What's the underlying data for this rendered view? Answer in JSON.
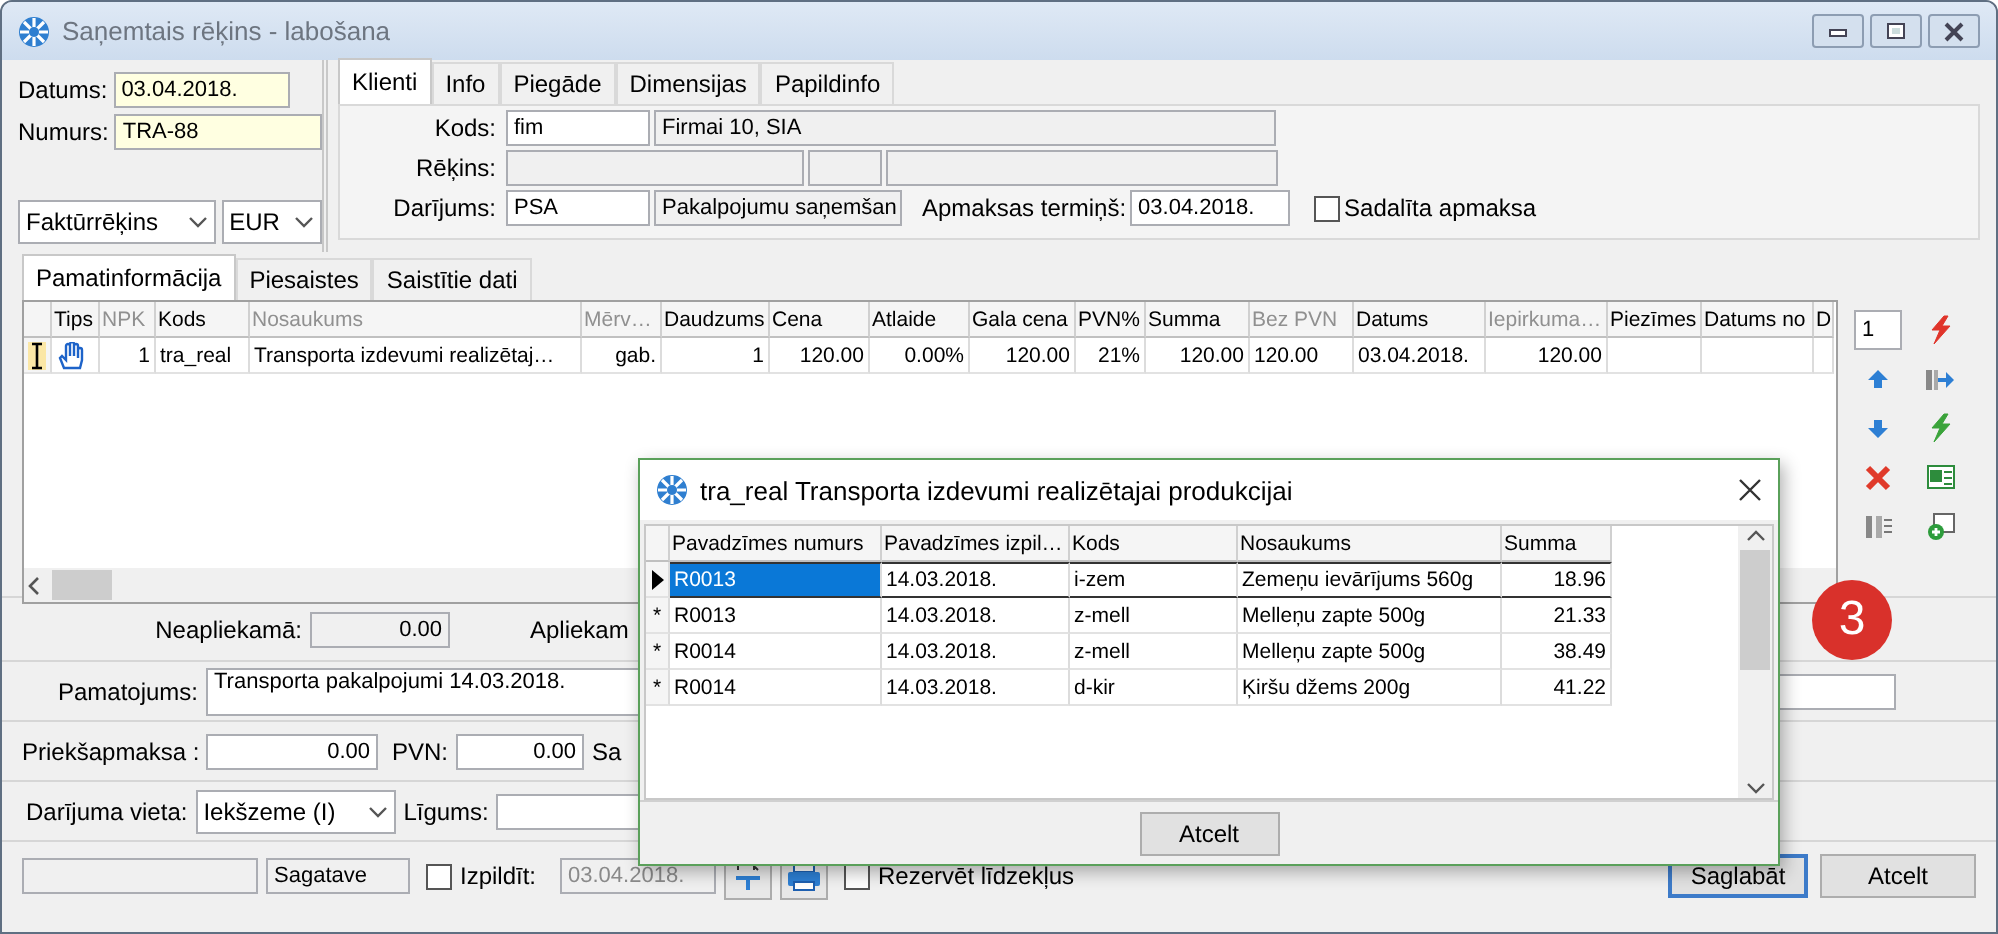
{
  "window": {
    "title": "Saņemtais rēķins - labošana"
  },
  "header": {
    "fields": [
      {
        "label": "Datums:",
        "value": "03.04.2018."
      },
      {
        "label": "Numurs:",
        "value": "TRA-88"
      }
    ],
    "selects": [
      {
        "value": "Faktūrrēķins"
      },
      {
        "value": "EUR"
      }
    ]
  },
  "client_tabs": [
    {
      "label": "Klienti",
      "selected": true
    },
    {
      "label": "Info",
      "selected": false
    },
    {
      "label": "Piegāde",
      "selected": false
    },
    {
      "label": "Dimensijas",
      "selected": false
    },
    {
      "label": "Papildinfo",
      "selected": false
    }
  ],
  "client": {
    "rows": [
      {
        "kind": "pair",
        "label": "Kods:",
        "fields": [
          "fim",
          "Firmai 10, SIA"
        ]
      },
      {
        "kind": "triple",
        "label": "Rēķins:"
      },
      {
        "kind": "pair",
        "label": "Darījums:",
        "fields": [
          "PSA",
          "Pakalpojumu saņemšan"
        ]
      }
    ],
    "payment_term": {
      "label": "Apmaksas termiņš:",
      "value": "03.04.2018."
    },
    "split_payment": {
      "label": "Sadalīta apmaksa",
      "checked": false
    }
  },
  "detail_tabs": [
    {
      "label": "Pamatinformācija",
      "selected": true
    },
    {
      "label": "Piesaistes",
      "selected": false
    },
    {
      "label": "Saistītie dati",
      "selected": false
    }
  ],
  "table": {
    "columns": [
      {
        "label": "Tips",
        "dim": false
      },
      {
        "label": "NPK",
        "dim": true
      },
      {
        "label": "Kods",
        "dim": false
      },
      {
        "label": "Nosaukums",
        "dim": true
      },
      {
        "label": "Mērv…",
        "dim": true
      },
      {
        "label": "Daudzums",
        "dim": false
      },
      {
        "label": "Cena",
        "dim": false
      },
      {
        "label": "Atlaide",
        "dim": false
      },
      {
        "label": "Gala cena",
        "dim": false
      },
      {
        "label": "PVN%",
        "dim": false
      },
      {
        "label": "Summa",
        "dim": false
      },
      {
        "label": "Bez PVN",
        "dim": true
      },
      {
        "label": "Datums",
        "dim": false
      },
      {
        "label": "Iepirkuma…",
        "dim": true
      },
      {
        "label": "Piezīmes",
        "dim": false
      },
      {
        "label": "Datums no",
        "dim": false
      },
      {
        "label": "D",
        "dim": false
      }
    ],
    "rows": [
      {
        "cells": [
          "",
          "1",
          "tra_real",
          "Transporta izdevumi realizētaj…",
          "gab.",
          "1",
          "120.00",
          "0.00%",
          "120.00",
          "21%",
          "120.00",
          "120.00",
          "03.04.2018.",
          "120.00",
          "",
          "",
          ""
        ]
      }
    ]
  },
  "counter": "1",
  "totals": {
    "untaxed": {
      "label": "Neapliekamā:",
      "value": "0.00"
    },
    "taxed_label": "Apliekam"
  },
  "basis": {
    "label": "Pamatojums:",
    "value": "Transporta pakalpojumi 14.03.2018."
  },
  "prepayment": {
    "label": "Priekšapmaksa :",
    "value": "0.00"
  },
  "vat": {
    "label": "PVN:",
    "value": "0.00"
  },
  "cut_label": "Sa",
  "place": {
    "label": "Darījuma vieta:",
    "value": "Iekšzeme (I)"
  },
  "contract": {
    "label": "Līgums:"
  },
  "footer": {
    "status": "Sagatave",
    "execute": {
      "label": "Izpildīt:",
      "checked": false
    },
    "execute_date": {
      "value": "03.04.2018.",
      "disabled": true
    },
    "reserve": {
      "label": "Rezervēt līdzekļus",
      "checked": false
    },
    "buttons": [
      {
        "label": "Saglabāt",
        "focused": true
      },
      {
        "label": "Atcelt",
        "focused": false
      }
    ]
  },
  "dialog": {
    "title": "tra_real Transporta izdevumi realizētajai produkcijai",
    "columns": [
      "Pavadzīmes numurs",
      "Pavadzīmes izpil…",
      "Kods",
      "Nosaukums",
      "Summa"
    ],
    "rows": [
      {
        "selected": true,
        "cells": [
          "R0013",
          "14.03.2018.",
          "i-zem",
          "Zemeņu ievārījums 560g",
          "18.96"
        ]
      },
      {
        "selected": false,
        "marker": "*",
        "cells": [
          "R0013",
          "14.03.2018.",
          "z-mell",
          "Melleņu zapte 500g",
          "21.33"
        ]
      },
      {
        "selected": false,
        "marker": "*",
        "cells": [
          "R0014",
          "14.03.2018.",
          "z-mell",
          "Melleņu zapte 500g",
          "38.49"
        ]
      },
      {
        "selected": false,
        "marker": "*",
        "cells": [
          "R0014",
          "14.03.2018.",
          "d-kir",
          "Ķiršu džems 200g",
          "41.22"
        ]
      }
    ],
    "button": "Atcelt"
  },
  "badge": "3"
}
